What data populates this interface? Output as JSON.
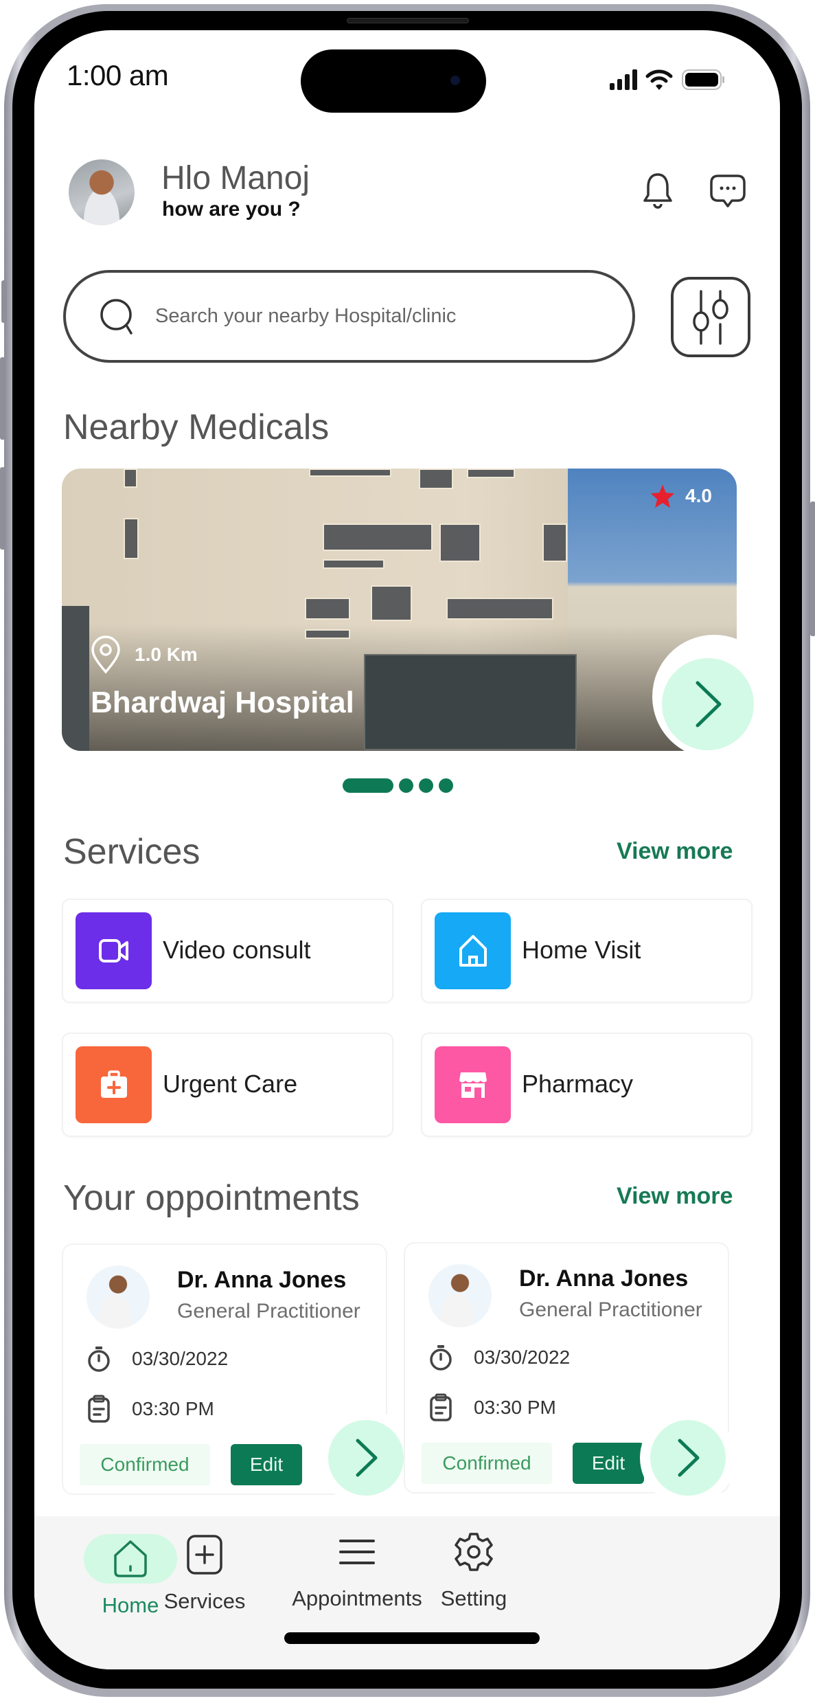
{
  "status_bar": {
    "time": "1:00 am",
    "icons": [
      "signal-icon",
      "wifi-icon",
      "battery-icon"
    ]
  },
  "header": {
    "greeting": "Hlo Manoj",
    "subtitle": "how are you ?",
    "icons": [
      "bell-icon",
      "chat-icon"
    ]
  },
  "search": {
    "placeholder": "Search your nearby Hospital/clinic",
    "value": "",
    "filter_icon": "sliders-icon"
  },
  "nearby": {
    "title": "Nearby Medicals",
    "cards": [
      {
        "name": "Bhardwaj Hospital",
        "distance": "1.0 Km",
        "rating": "4.0"
      }
    ],
    "pagination": {
      "total": 4,
      "active": 1
    }
  },
  "services": {
    "title": "Services",
    "view_more": "View more",
    "items": [
      {
        "label": "Video consult",
        "icon": "video-camera-icon",
        "color": "#6c2ee8"
      },
      {
        "label": "Home Visit",
        "icon": "house-icon",
        "color": "#16a9f5"
      },
      {
        "label": "Urgent Care",
        "icon": "medical-kit-icon",
        "color": "#f8663c"
      },
      {
        "label": "Pharmacy",
        "icon": "storefront-icon",
        "color": "#fd58a4"
      }
    ]
  },
  "appointments": {
    "title": "Your oppointments",
    "view_more": "View more",
    "items": [
      {
        "doctor": "Dr. Anna Jones",
        "specialty": "General Practitioner",
        "date": "03/30/2022",
        "time": "03:30 PM",
        "status": "Confirmed",
        "edit_label": "Edit"
      },
      {
        "doctor": "Dr. Anna Jones",
        "specialty": "General Practitioner",
        "date": "03/30/2022",
        "time": "03:30 PM",
        "status": "Confirmed",
        "edit_label": "Edit"
      }
    ]
  },
  "bottom_nav": {
    "items": [
      {
        "label": "Home",
        "icon": "home-icon",
        "active": true
      },
      {
        "label": "Services",
        "icon": "plus-square-icon",
        "active": false
      },
      {
        "label": "Appointments",
        "icon": "menu-icon",
        "active": false
      },
      {
        "label": "Setting",
        "icon": "gear-icon",
        "active": false
      }
    ]
  },
  "colors": {
    "brand": "#0c7a55",
    "accent_light": "#d3fae6",
    "confirmed_bg": "#effbf3",
    "rating_star": "#e8202e"
  }
}
